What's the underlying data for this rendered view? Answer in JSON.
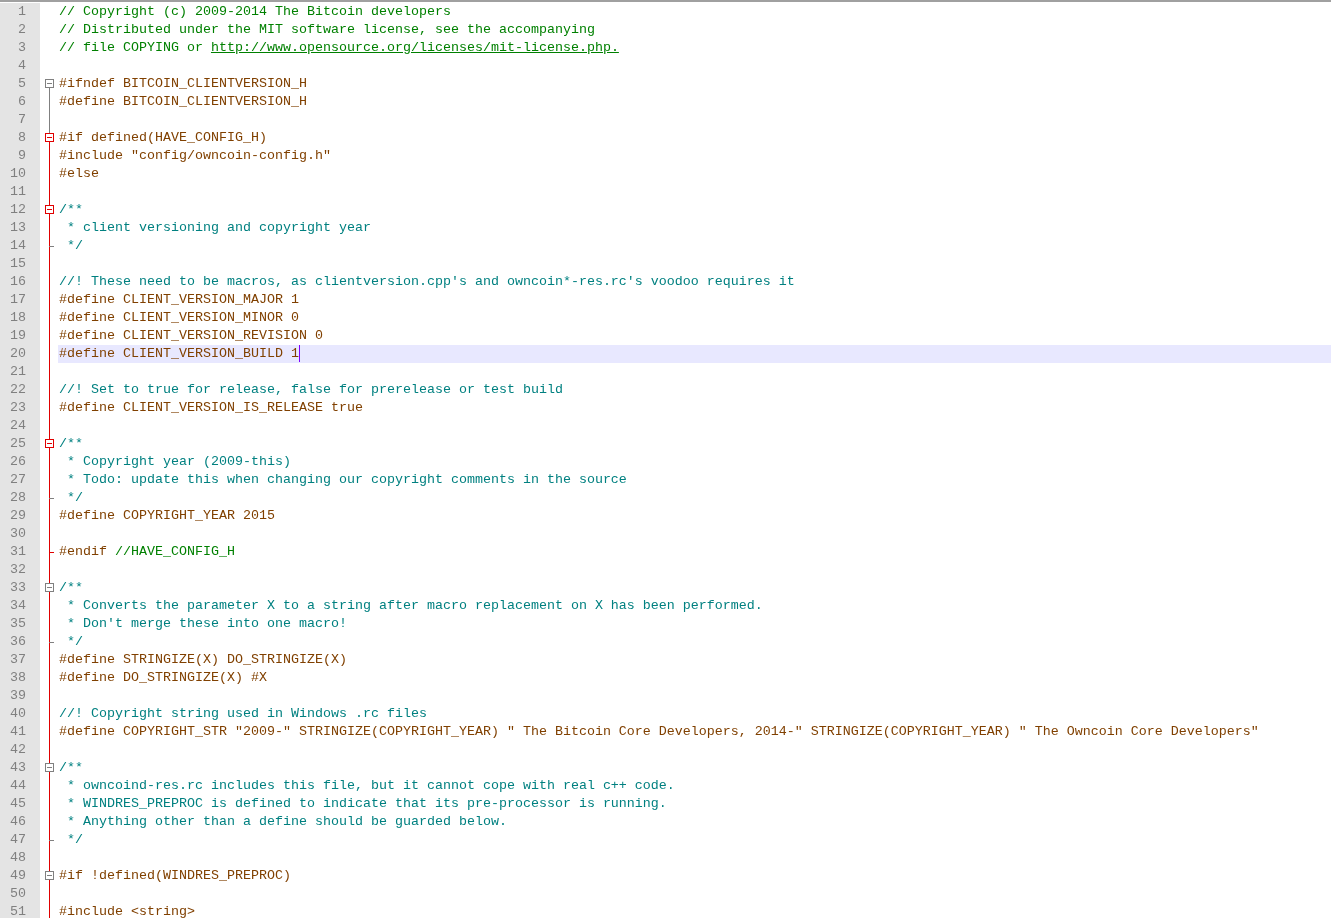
{
  "editor": {
    "lines": [
      {
        "number": "1",
        "segments": [
          {
            "kind": "comment",
            "text": "// Copyright (c) 2009-2014 The Bitcoin developers"
          }
        ]
      },
      {
        "number": "2",
        "segments": [
          {
            "kind": "comment",
            "text": "// Distributed under the MIT software license, see the accompanying"
          }
        ]
      },
      {
        "number": "3",
        "segments": [
          {
            "kind": "comment",
            "text": "// file COPYING or "
          },
          {
            "kind": "link",
            "text": "http://www.opensource.org/licenses/mit-license.php."
          }
        ]
      },
      {
        "number": "4"
      },
      {
        "number": "5",
        "fold": {
          "kind": "start",
          "active": false
        },
        "segments": [
          {
            "kind": "preproc",
            "text": "#ifndef BITCOIN_CLIENTVERSION_H"
          }
        ]
      },
      {
        "number": "6",
        "segments": [
          {
            "kind": "preproc",
            "text": "#define BITCOIN_CLIENTVERSION_H"
          }
        ]
      },
      {
        "number": "7"
      },
      {
        "number": "8",
        "fold": {
          "kind": "start",
          "active": true
        },
        "segments": [
          {
            "kind": "preproc",
            "text": "#if defined(HAVE_CONFIG_H)"
          }
        ]
      },
      {
        "number": "9",
        "segments": [
          {
            "kind": "preproc",
            "text": "#include \"config/owncoin-config.h\""
          }
        ]
      },
      {
        "number": "10",
        "segments": [
          {
            "kind": "preproc",
            "text": "#else"
          }
        ]
      },
      {
        "number": "11"
      },
      {
        "number": "12",
        "fold": {
          "kind": "start",
          "active": true
        },
        "segments": [
          {
            "kind": "doc",
            "text": "/**"
          }
        ]
      },
      {
        "number": "13",
        "segments": [
          {
            "kind": "doc",
            "text": " * client versioning and copyright year"
          }
        ]
      },
      {
        "number": "14",
        "fold": {
          "kind": "end",
          "active": false
        },
        "segments": [
          {
            "kind": "doc",
            "text": " */"
          }
        ]
      },
      {
        "number": "15"
      },
      {
        "number": "16",
        "segments": [
          {
            "kind": "doc",
            "text": "//! These need to be macros, as clientversion.cpp's and owncoin*-res.rc's voodoo requires it"
          }
        ]
      },
      {
        "number": "17",
        "segments": [
          {
            "kind": "preproc",
            "text": "#define CLIENT_VERSION_MAJOR 1"
          }
        ]
      },
      {
        "number": "18",
        "segments": [
          {
            "kind": "preproc",
            "text": "#define CLIENT_VERSION_MINOR 0"
          }
        ]
      },
      {
        "number": "19",
        "segments": [
          {
            "kind": "preproc",
            "text": "#define CLIENT_VERSION_REVISION 0"
          }
        ]
      },
      {
        "number": "20",
        "current": true,
        "segments": [
          {
            "kind": "preproc",
            "text": "#define CLIENT_VERSION_BUILD 1"
          }
        ]
      },
      {
        "number": "21"
      },
      {
        "number": "22",
        "segments": [
          {
            "kind": "doc",
            "text": "//! Set to true for release, false for prerelease or test build"
          }
        ]
      },
      {
        "number": "23",
        "segments": [
          {
            "kind": "preproc",
            "text": "#define CLIENT_VERSION_IS_RELEASE true"
          }
        ]
      },
      {
        "number": "24"
      },
      {
        "number": "25",
        "fold": {
          "kind": "start",
          "active": true
        },
        "segments": [
          {
            "kind": "doc",
            "text": "/**"
          }
        ]
      },
      {
        "number": "26",
        "segments": [
          {
            "kind": "doc",
            "text": " * Copyright year (2009-this)"
          }
        ]
      },
      {
        "number": "27",
        "segments": [
          {
            "kind": "doc",
            "text": " * Todo: update this when changing our copyright comments in the source"
          }
        ]
      },
      {
        "number": "28",
        "fold": {
          "kind": "end",
          "active": false
        },
        "segments": [
          {
            "kind": "doc",
            "text": " */"
          }
        ]
      },
      {
        "number": "29",
        "segments": [
          {
            "kind": "preproc",
            "text": "#define COPYRIGHT_YEAR 2015"
          }
        ]
      },
      {
        "number": "30"
      },
      {
        "number": "31",
        "fold": {
          "kind": "end",
          "active": true
        },
        "segments": [
          {
            "kind": "preproc",
            "text": "#endif "
          },
          {
            "kind": "comment",
            "text": "//HAVE_CONFIG_H"
          }
        ]
      },
      {
        "number": "32"
      },
      {
        "number": "33",
        "fold": {
          "kind": "start",
          "active": false
        },
        "segments": [
          {
            "kind": "doc",
            "text": "/**"
          }
        ]
      },
      {
        "number": "34",
        "segments": [
          {
            "kind": "doc",
            "text": " * Converts the parameter X to a string after macro replacement on X has been performed."
          }
        ]
      },
      {
        "number": "35",
        "segments": [
          {
            "kind": "doc",
            "text": " * Don't merge these into one macro!"
          }
        ]
      },
      {
        "number": "36",
        "fold": {
          "kind": "end",
          "active": false
        },
        "segments": [
          {
            "kind": "doc",
            "text": " */"
          }
        ]
      },
      {
        "number": "37",
        "segments": [
          {
            "kind": "preproc",
            "text": "#define STRINGIZE(X) DO_STRINGIZE(X)"
          }
        ]
      },
      {
        "number": "38",
        "segments": [
          {
            "kind": "preproc",
            "text": "#define DO_STRINGIZE(X) #X"
          }
        ]
      },
      {
        "number": "39"
      },
      {
        "number": "40",
        "segments": [
          {
            "kind": "doc",
            "text": "//! Copyright string used in Windows .rc files"
          }
        ]
      },
      {
        "number": "41",
        "segments": [
          {
            "kind": "preproc",
            "text": "#define COPYRIGHT_STR \"2009-\" STRINGIZE(COPYRIGHT_YEAR) \" The Bitcoin Core Developers, 2014-\" STRINGIZE(COPYRIGHT_YEAR) \" The Owncoin Core Developers\""
          }
        ]
      },
      {
        "number": "42"
      },
      {
        "number": "43",
        "fold": {
          "kind": "start",
          "active": false
        },
        "segments": [
          {
            "kind": "doc",
            "text": "/**"
          }
        ]
      },
      {
        "number": "44",
        "segments": [
          {
            "kind": "doc",
            "text": " * owncoind-res.rc includes this file, but it cannot cope with real c++ code."
          }
        ]
      },
      {
        "number": "45",
        "segments": [
          {
            "kind": "doc",
            "text": " * WINDRES_PREPROC is defined to indicate that its pre-processor is running."
          }
        ]
      },
      {
        "number": "46",
        "segments": [
          {
            "kind": "doc",
            "text": " * Anything other than a define should be guarded below."
          }
        ]
      },
      {
        "number": "47",
        "fold": {
          "kind": "end",
          "active": false
        },
        "segments": [
          {
            "kind": "doc",
            "text": " */"
          }
        ]
      },
      {
        "number": "48"
      },
      {
        "number": "49",
        "fold": {
          "kind": "start",
          "active": false
        },
        "segments": [
          {
            "kind": "preproc",
            "text": "#if !defined(WINDRES_PREPROC)"
          }
        ]
      },
      {
        "number": "50"
      },
      {
        "number": "51",
        "segments": [
          {
            "kind": "preproc",
            "text": "#include <string>"
          }
        ]
      }
    ]
  }
}
